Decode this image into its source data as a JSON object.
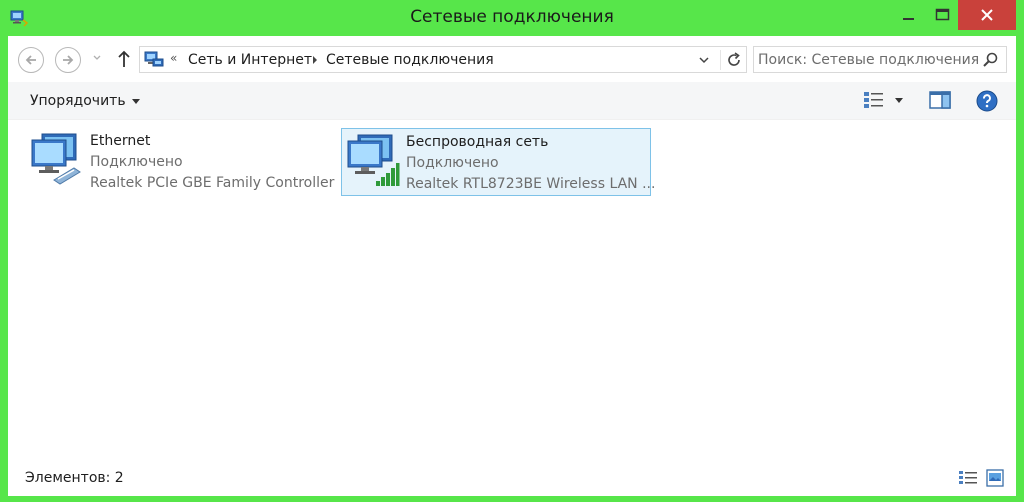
{
  "window": {
    "title": "Сетевые подключения",
    "accent_color": "#57e64a",
    "close_color": "#c9413b"
  },
  "address_bar": {
    "overflow_chevron": "«",
    "breadcrumbs": [
      "Сеть и Интернет",
      "Сетевые подключения"
    ]
  },
  "search": {
    "placeholder": "Поиск: Сетевые подключения",
    "value": ""
  },
  "toolbar": {
    "organize_label": "Упорядочить",
    "icons": [
      "change-view-icon",
      "preview-pane-icon",
      "help-icon"
    ]
  },
  "connections": [
    {
      "name": "Ethernet",
      "status": "Подключено",
      "device": "Realtek PCIe GBE Family Controller",
      "icon": "ethernet-adapter-icon",
      "selected": false
    },
    {
      "name": "Беспроводная сеть",
      "status": "Подключено",
      "device": "Realtek RTL8723BE Wireless LAN ...",
      "icon": "wireless-adapter-icon",
      "selected": true
    }
  ],
  "status_bar": {
    "item_count": "Элементов: 2"
  }
}
